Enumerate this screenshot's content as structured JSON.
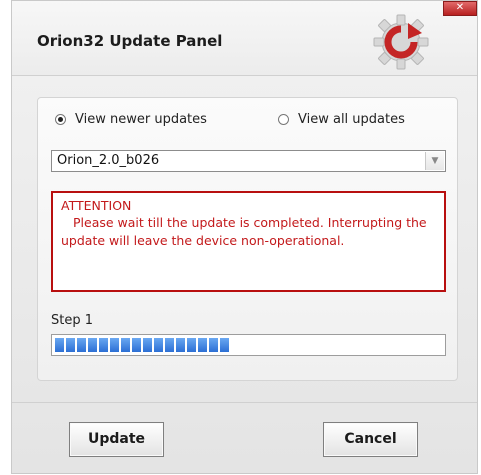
{
  "window": {
    "title": "Orion32 Update Panel",
    "close_glyph": "✕"
  },
  "options": {
    "newer_label": "View newer updates",
    "all_label": "View all updates",
    "selected": "newer"
  },
  "version_select": {
    "value": "Orion_2.0_b026"
  },
  "attention": {
    "heading": "ATTENTION",
    "message": "Please wait till the update is completed. Interrupting the update will leave the device non-operational."
  },
  "progress": {
    "step_label": "Step 1",
    "percent": 45
  },
  "buttons": {
    "update": "Update",
    "cancel": "Cancel"
  },
  "colors": {
    "attention_red": "#c3191b",
    "progress_blue": "#2c6fd4"
  },
  "icons": {
    "logo": "gear-refresh-icon",
    "close": "close-icon",
    "dropdown": "chevron-down-icon"
  }
}
